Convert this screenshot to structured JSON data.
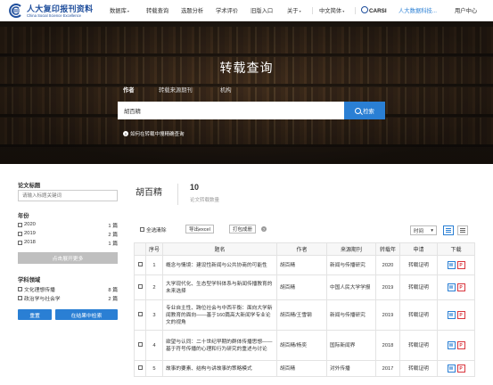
{
  "brand": {
    "name_cn": "人大复印报刊资料",
    "name_en": "China Social Science Excellence"
  },
  "nav": {
    "items": [
      {
        "label": "数据库",
        "caret": "▾"
      },
      {
        "label": "转载查询"
      },
      {
        "label": "选题分析"
      },
      {
        "label": "学术评价"
      },
      {
        "label": "旧版入口"
      },
      {
        "label": "关于",
        "caret": "▾"
      },
      {
        "label": "中文简体",
        "caret": "▾"
      },
      {
        "label": "CARSI"
      },
      {
        "label": "人大数据科技..."
      },
      {
        "label": "用户中心"
      }
    ]
  },
  "hero": {
    "title": "转载查询",
    "tabs": [
      "作者",
      "转载来源期刊",
      "机构"
    ],
    "search_value": "胡百精",
    "search_button": "检索",
    "hint": "如何在转载中搜精确查询"
  },
  "sidebar": {
    "title_heading": "论文标题",
    "title_placeholder": "请输入标题关键词",
    "year_heading": "年份",
    "years": [
      {
        "label": "2020",
        "count": "1 篇"
      },
      {
        "label": "2019",
        "count": "2 篇"
      },
      {
        "label": "2018",
        "count": "1 篇"
      }
    ],
    "expand_label": "点击展开更多",
    "field_heading": "学科领域",
    "fields": [
      {
        "label": "文化理想传播",
        "count": "8 篇"
      },
      {
        "label": "政治学与社会学",
        "count": "2 篇"
      }
    ],
    "reset_label": "重置",
    "refine_label": "在结果中检索"
  },
  "result": {
    "name": "胡百精",
    "count": "10",
    "count_label": "论文转载数量"
  },
  "toolbar": {
    "select_all": "全选",
    "clear": "清除",
    "export": "导出excel",
    "print": "打包成册",
    "help": "?",
    "sort": "时间",
    "sort_caret": "▾"
  },
  "table": {
    "headers": [
      "",
      "序号",
      "题名",
      "作者",
      "来源期刊",
      "转载年",
      "申请",
      "下载"
    ],
    "rows": [
      {
        "no": "1",
        "title": "概念与情境：建设性新闻与公共协商的可能性",
        "author": "胡百精",
        "source": "新闻与传播研究",
        "year": "2020",
        "apply": "转载证明",
        "w": "W",
        "p": "P"
      },
      {
        "no": "2",
        "title": "大学现代化、生态型学科体系与新闻传播教育的未来选择",
        "author": "胡百精",
        "source": "中国人民大学学报",
        "year": "2019",
        "apply": "转载证明",
        "w": "W",
        "p": "P"
      },
      {
        "no": "3",
        "title": "专业自主性、跨位社会与中西平衡：面向大学新闻教育的面向——基于160篇高大新闻学专业论文的视角",
        "author": "胡百精/王雪钢",
        "source": "新闻与传播研究",
        "year": "2019",
        "apply": "转载证明",
        "w": "W",
        "p": "P"
      },
      {
        "no": "4",
        "title": "欲望与认同：二十世纪早期的群体传播思想——基于符号传播的心理和行为研究的重述与讨论",
        "author": "胡百精/杨奕",
        "source": "国际新闻界",
        "year": "2018",
        "apply": "转载证明",
        "w": "W",
        "p": "P"
      },
      {
        "no": "5",
        "title": "故事的要素、结构与讲故事的策略模式",
        "author": "胡百精",
        "source": "对外传播",
        "year": "2017",
        "apply": "转载证明",
        "w": "W",
        "p": "P"
      }
    ]
  }
}
